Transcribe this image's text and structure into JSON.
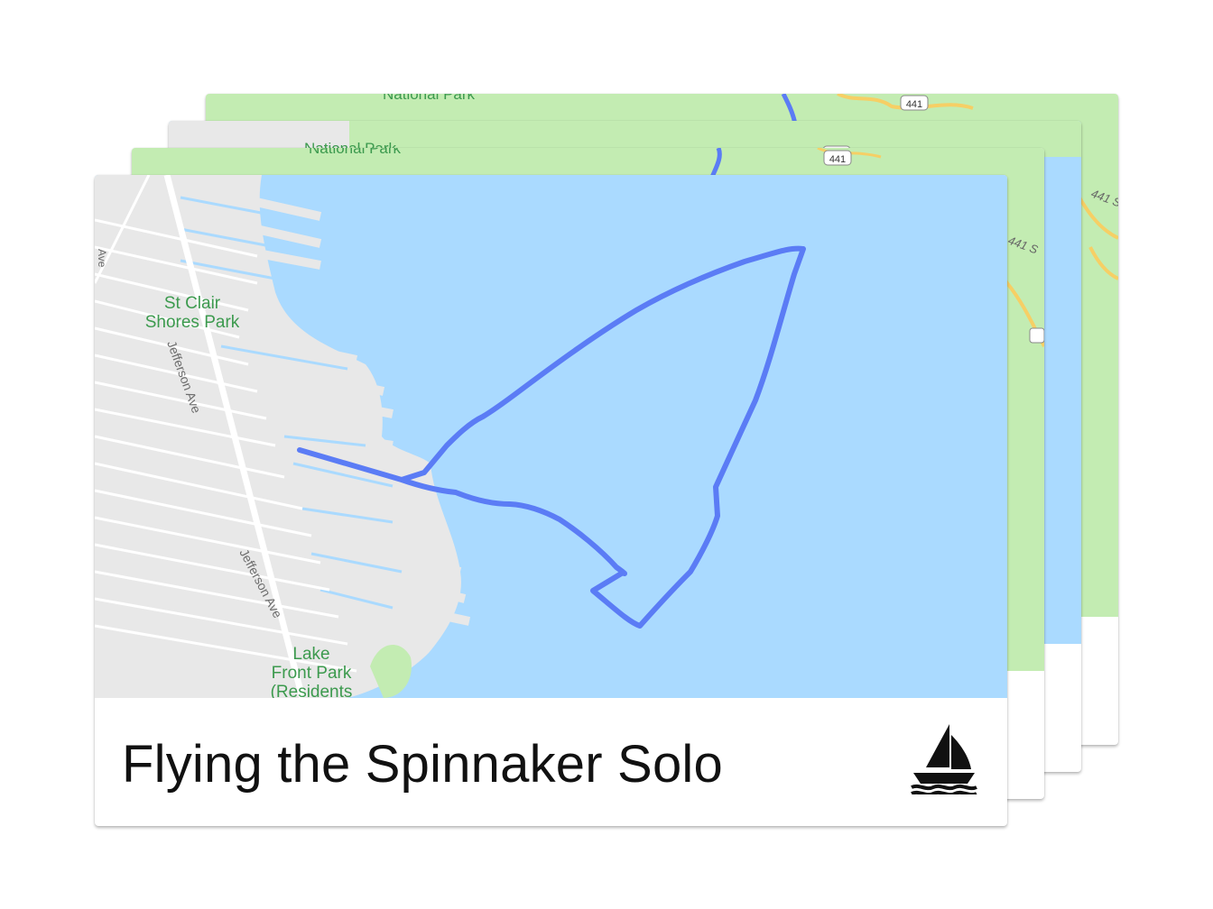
{
  "colors": {
    "water": "#aadaff",
    "land_gray": "#e8e8e8",
    "road_white": "#ffffff",
    "park_green": "#c3ecb2",
    "track_blue": "#5b7cf5",
    "highway_yellow": "#f6cf65"
  },
  "stacked_cards": [
    {
      "map": {
        "park_label": "National Park",
        "route_shield": "441",
        "road_label": "441 S"
      },
      "footer_icon": "footprints-icon"
    },
    {
      "map": {
        "park_label": "National Park",
        "route_shield": "441"
      },
      "footer_icon": "sailboat-icon"
    },
    {
      "map": {
        "park_label": "National Park",
        "route_shield": "441",
        "road_label": "441 S"
      },
      "footer_icon": "hiking-icon"
    }
  ],
  "front_card": {
    "title": "Flying the Spinnaker Solo",
    "activity_icon": "sailboat-icon",
    "map": {
      "labels": {
        "park1_line1": "St Clair",
        "park1_line2": "Shores Park",
        "street1": "Jefferson Ave",
        "street2": "Jefferson Ave",
        "park2_line1": "Lake",
        "park2_line2": "Front Park",
        "park2_line3": "(Residents",
        "edge_street": "Ave"
      }
    }
  }
}
